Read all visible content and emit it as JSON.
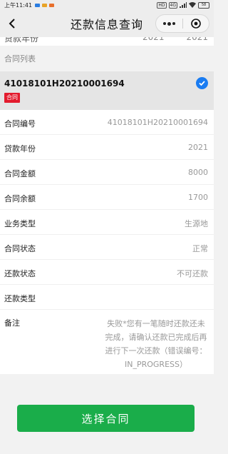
{
  "status_bar": {
    "time": "上午11:41",
    "battery": "58",
    "net_chip": "4G",
    "hd_chip": "HD"
  },
  "nav": {
    "title": "还款信息查询",
    "icons": [
      "back-icon",
      "more-dots-icon",
      "close-circle-icon"
    ]
  },
  "cut_row": {
    "label": "贷款年份",
    "value1": "2021",
    "value2": "2021"
  },
  "section": {
    "title": "合同列表"
  },
  "contract": {
    "number": "41018101H20210001694",
    "tag": "合同",
    "selected": true,
    "accent": "#1a7cf2",
    "tag_color": "#e31b2d"
  },
  "details": {
    "rows": [
      {
        "label": "合同编号",
        "value": "41018101H20210001694"
      },
      {
        "label": "贷款年份",
        "value": "2021"
      },
      {
        "label": "合同金额",
        "value": "8000"
      },
      {
        "label": "合同余额",
        "value": "1700"
      },
      {
        "label": "业务类型",
        "value": "生源地"
      },
      {
        "label": "合同状态",
        "value": "正常"
      },
      {
        "label": "还款状态",
        "value": "不可还款"
      },
      {
        "label": "还款类型",
        "value": ""
      }
    ],
    "note": {
      "label": "备注",
      "value": "失败*您有一笔随时还款还未完成，请确认还款已完成后再进行下一次还款（错误编号：IN_PROGRESS）"
    }
  },
  "action": {
    "label": "选择合同",
    "color": "#1aad4a"
  }
}
